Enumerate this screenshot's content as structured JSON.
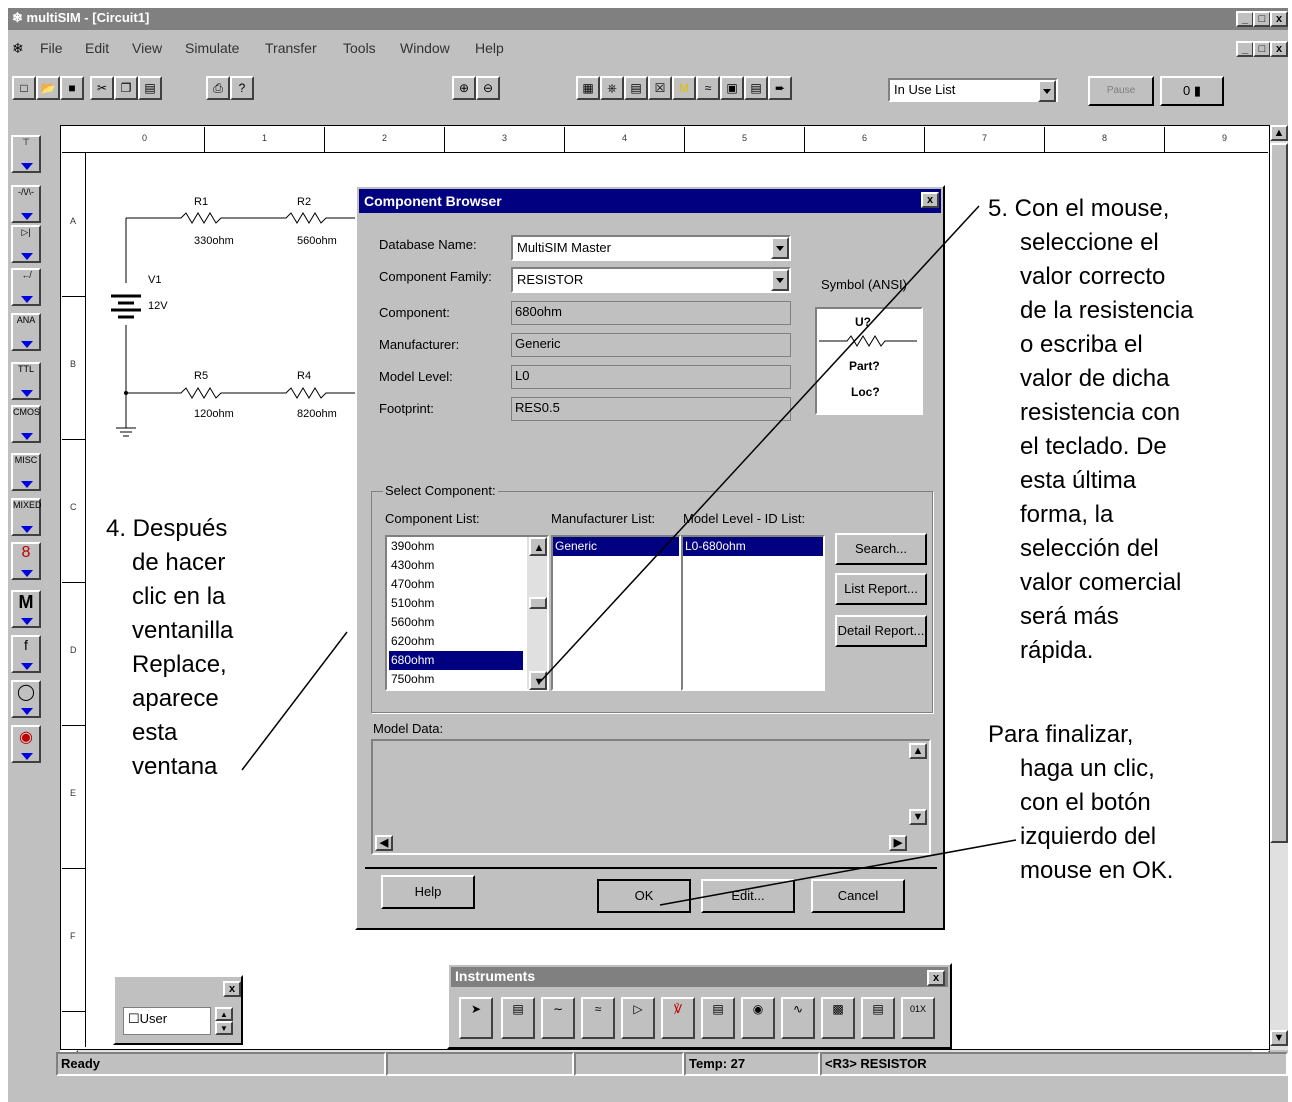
{
  "window": {
    "title": "multiSIM - [Circuit1]",
    "ctl_min": "_",
    "ctl_max": "□",
    "ctl_close": "x"
  },
  "menu": [
    "File",
    "Edit",
    "View",
    "Simulate",
    "Transfer",
    "Tools",
    "Window",
    "Help"
  ],
  "toolbar": {
    "in_use_list": "In Use List",
    "pause": "Pause",
    "help_symbol": "?"
  },
  "ruler": {
    "cols": [
      "0",
      "1",
      "2",
      "3",
      "4",
      "5",
      "6",
      "7",
      "8",
      "9"
    ],
    "rows": [
      "A",
      "B",
      "C",
      "D",
      "E",
      "F"
    ]
  },
  "circuit": {
    "r1": {
      "name": "R1",
      "value": "330ohm"
    },
    "r2": {
      "name": "R2",
      "value": "560ohm"
    },
    "r5": {
      "name": "R5",
      "value": "120ohm"
    },
    "r4": {
      "name": "R4",
      "value": "820ohm"
    },
    "v1": {
      "name": "V1",
      "value": "12V"
    }
  },
  "dialog": {
    "title": "Component Browser",
    "database_label": "Database Name:",
    "database_value": "MultiSIM Master",
    "family_label": "Component Family:",
    "family_value": "RESISTOR",
    "component_label": "Component:",
    "component_value": "680ohm",
    "manufacturer_label": "Manufacturer:",
    "manufacturer_value": "Generic",
    "model_level_label": "Model Level:",
    "model_level_value": "L0",
    "footprint_label": "Footprint:",
    "footprint_value": "RES0.5",
    "symbol_label": "Symbol (ANSI)",
    "symbol_u": "U?",
    "symbol_part": "Part?",
    "symbol_loc": "Loc?",
    "select_group": "Select Component:",
    "component_list_label": "Component List:",
    "manufacturer_list_label": "Manufacturer List:",
    "model_list_label": "Model Level - ID List:",
    "component_list": [
      "390ohm",
      "430ohm",
      "470ohm",
      "510ohm",
      "560ohm",
      "620ohm",
      "680ohm",
      "750ohm"
    ],
    "manufacturer_list": [
      "Generic"
    ],
    "model_list": [
      "L0-680ohm"
    ],
    "search_btn": "Search...",
    "list_report_btn": "List Report...",
    "detail_report_btn": "Detail Report...",
    "model_data_label": "Model Data:",
    "help_btn": "Help",
    "ok_btn": "OK",
    "edit_btn": "Edit...",
    "cancel_btn": "Cancel"
  },
  "user_panel": {
    "checkbox_label": "User"
  },
  "instruments": {
    "title": "Instruments"
  },
  "status": {
    "ready": "Ready",
    "temp": "Temp: 27",
    "selection": "<R3> RESISTOR"
  },
  "annotations": {
    "left": [
      "4. Después",
      "de hacer",
      "clic en la",
      "ventanilla",
      "Replace,",
      "aparece",
      "esta",
      "ventana"
    ],
    "right_top": [
      "5. Con el mouse,",
      "seleccione el",
      "valor correcto",
      "de la resistencia",
      "o escriba el",
      "valor de dicha",
      "resistencia con",
      "el teclado.  De",
      "esta última",
      "forma, la",
      "selección del",
      "valor comercial",
      "será más",
      "rápida."
    ],
    "right_bottom": [
      "Para finalizar,",
      "haga un clic,",
      "con el botón",
      "izquierdo del",
      "mouse en OK."
    ]
  }
}
